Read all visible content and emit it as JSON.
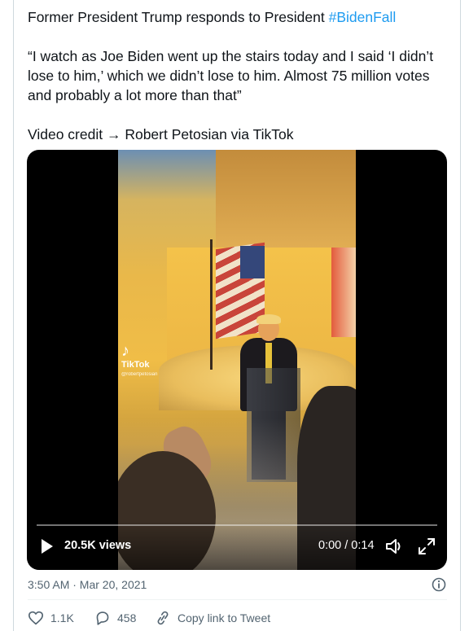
{
  "tweet": {
    "line1_prefix": "Former President Trump responds to President ",
    "hashtag": "#BidenFall",
    "quote": "“I watch as Joe Biden went up the stairs today and I said ‘I didn’t lose to him,’ which we didn’t lose to him. Almost 75 million votes and probably a lot more than that”",
    "credit": "Video credit → Robert Petosian via TikTok"
  },
  "video": {
    "watermark": {
      "brand": "TikTok",
      "handle": "@robertpetosian"
    },
    "views": "20.5K views",
    "time": "0:00 / 0:14",
    "progress": 0
  },
  "meta": {
    "timestamp": "3:50 AM · Mar 20, 2021"
  },
  "actions": {
    "likes": "1.1K",
    "replies": "458",
    "copy_link": "Copy link to Tweet"
  },
  "colors": {
    "link": "#1d9bf0",
    "text": "#0f1419",
    "secondary": "#536471",
    "border": "#cfd9de"
  },
  "icons": [
    "play-icon",
    "volume-icon",
    "fullscreen-icon",
    "info-icon",
    "heart-icon",
    "reply-icon",
    "link-icon"
  ]
}
